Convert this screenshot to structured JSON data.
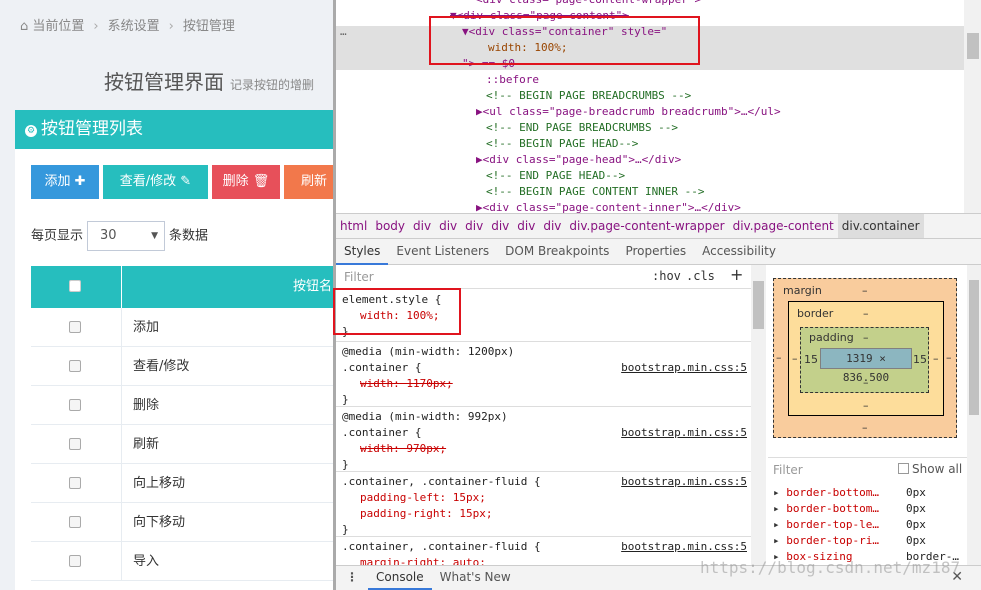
{
  "breadcrumb": {
    "items": [
      "当前位置",
      "系统设置",
      "按钮管理"
    ],
    "sep": "›"
  },
  "page": {
    "title": "按钮管理界面",
    "subtitle": "记录按钮的增删"
  },
  "panel": {
    "title": "按钮管理列表"
  },
  "toolbar": {
    "add": "添加 ✚",
    "edit": "查看/修改 ✎",
    "delete": "删除 🗑",
    "refresh": "刷新"
  },
  "paging": {
    "prefix": "每页显示",
    "value": "30",
    "suffix": "条数据"
  },
  "table": {
    "header": "按钮名",
    "rows": [
      "添加",
      "查看/修改",
      "删除",
      "刷新",
      "向上移动",
      "向下移动",
      "导入"
    ]
  },
  "elements": {
    "l0": "<div class=\"page-content-wrapper\">",
    "l1": "▼<div class=\"page-content\">",
    "l2a": "▼<div class=\"container\" style=\"",
    "l2b": "width: 100%;",
    "l2c": "\"> == $0",
    "l3": "::before",
    "l4": "<!-- BEGIN PAGE BREADCRUMBS -->",
    "l5": "▶<ul class=\"page-breadcrumb breadcrumb\">…</ul>",
    "l6": "<!-- END PAGE BREADCRUMBS -->",
    "l7": "<!-- BEGIN PAGE HEAD-->",
    "l8": "▶<div class=\"page-head\">…</div>",
    "l9": "<!-- END PAGE HEAD-->",
    "l10": "<!-- BEGIN PAGE CONTENT INNER -->",
    "l11": "▶<div class=\"page-content-inner\">…</div>",
    "ell": "…"
  },
  "crumbs": [
    "html",
    "body",
    "div",
    "div",
    "div",
    "div",
    "div",
    "div",
    "div.page-content-wrapper",
    "div.page-content",
    "div.container"
  ],
  "tabs": [
    "Styles",
    "Event Listeners",
    "DOM Breakpoints",
    "Properties",
    "Accessibility"
  ],
  "styles": {
    "filter": "Filter",
    "hov": ":hov",
    "cls": ".cls",
    "plus": "+",
    "r1a": "element.style {",
    "r1b": "width: 100%;",
    "close": "}",
    "r2m": "@media (min-width: 1200px)",
    "r2s": ".container {",
    "r2p": "width: 1170px;",
    "src": "bootstrap.min.css:5",
    "r3m": "@media (min-width: 992px)",
    "r3s": ".container {",
    "r3p": "width: 970px;",
    "r4s": ".container, .container-fluid {",
    "r4a": "padding-left: 15px;",
    "r4b": "padding-right: 15px;",
    "r5s": ".container, .container-fluid {",
    "r5a": "margin-right: auto;"
  },
  "boxmodel": {
    "margin": "margin",
    "border": "border",
    "padding": "padding",
    "dash": "–",
    "content": "1319 × 836.500",
    "pad_side": "15"
  },
  "computed": {
    "filter": "Filter",
    "show_all": "Show all",
    "rows": [
      {
        "k": "border-bottom…",
        "v": "0px"
      },
      {
        "k": "border-bottom…",
        "v": "0px"
      },
      {
        "k": "border-top-le…",
        "v": "0px"
      },
      {
        "k": "border-top-ri…",
        "v": "0px"
      },
      {
        "k": "box-sizing",
        "v": "border-…"
      }
    ]
  },
  "drawer": {
    "dots": "⋮",
    "console": "Console",
    "whatsnew": "What's New",
    "close": "✕"
  },
  "watermark": "https://blog.csdn.net/mz187"
}
